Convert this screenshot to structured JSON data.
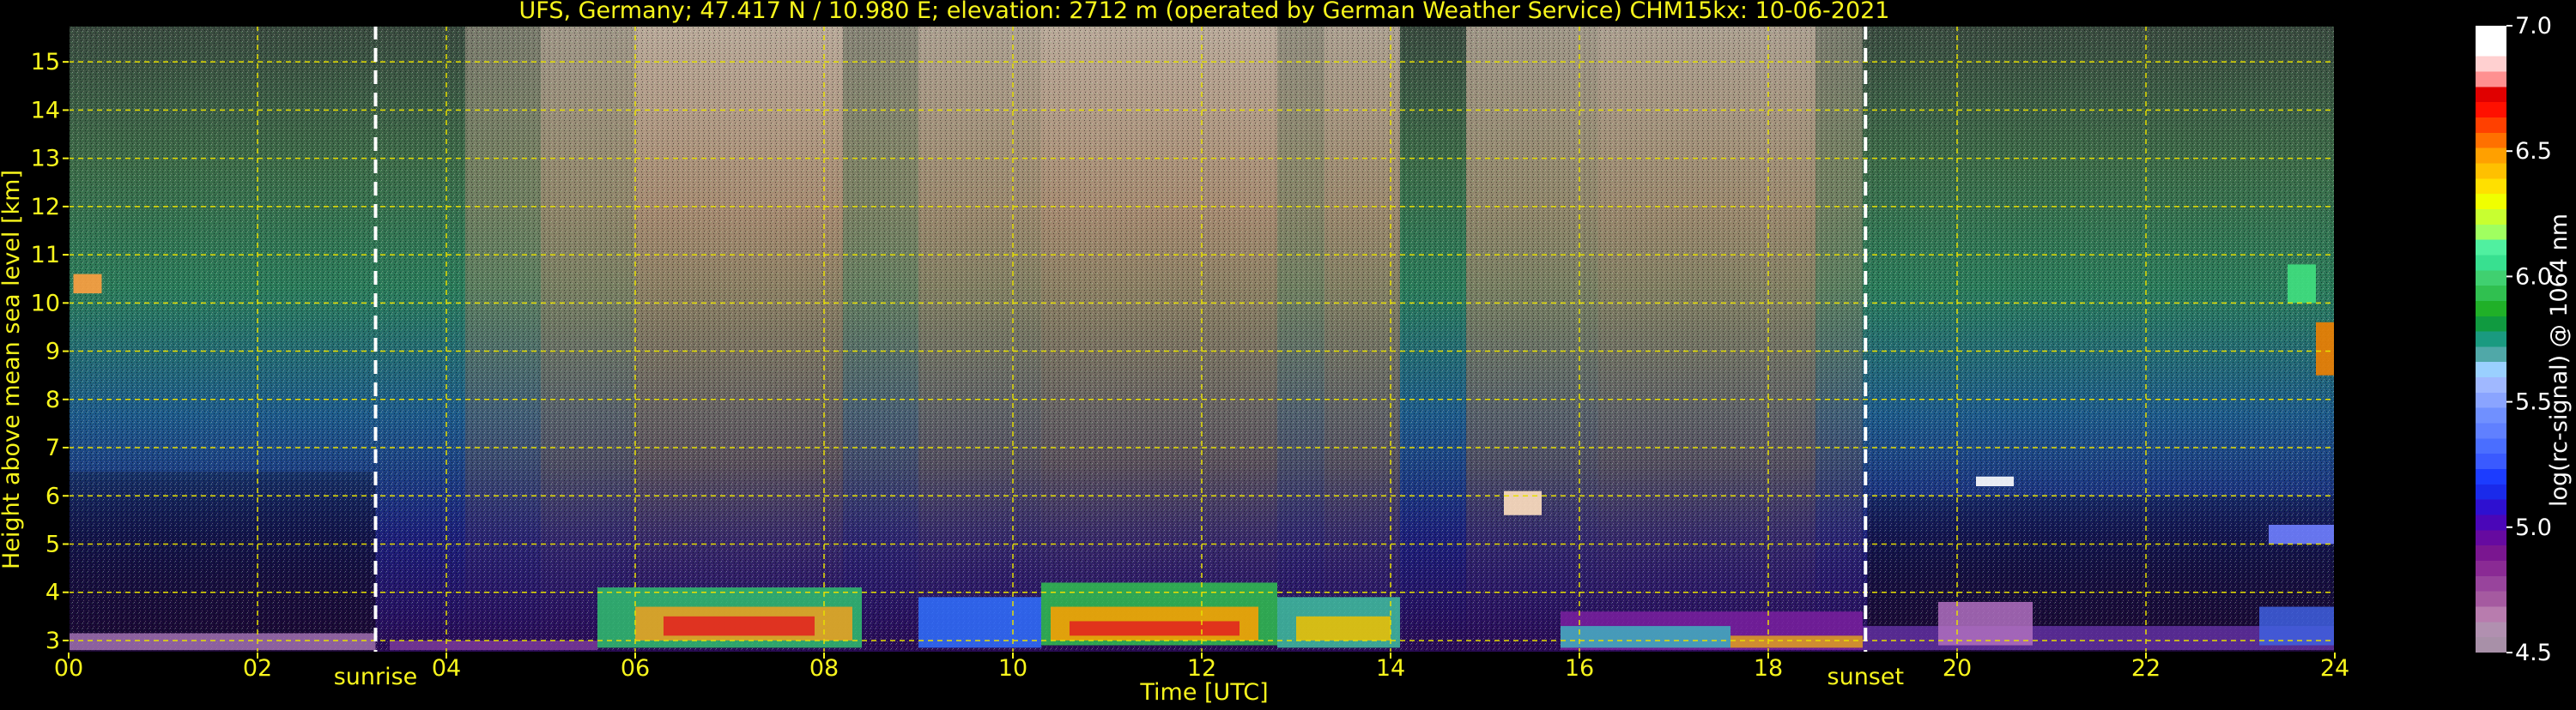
{
  "chart_data": {
    "type": "heatmap",
    "title": "UFS, Germany; 47.417 N / 10.980 E; elevation: 2712 m  (operated by German Weather Service)    CHM15kx: 10-06-2021",
    "xlabel": "Time [UTC]",
    "ylabel": "Height above mean sea level [km]",
    "xlim": [
      0,
      24
    ],
    "ylim": [
      2.75,
      15.75
    ],
    "x_ticks": [
      "00",
      "02",
      "04",
      "06",
      "08",
      "10",
      "12",
      "14",
      "16",
      "18",
      "20",
      "22",
      "24"
    ],
    "y_ticks": [
      "3",
      "4",
      "5",
      "6",
      "7",
      "8",
      "9",
      "10",
      "11",
      "12",
      "13",
      "14",
      "15"
    ],
    "grid": true,
    "annotations": [
      {
        "label": "sunrise",
        "x": 3.25
      },
      {
        "label": "sunset",
        "x": 19.03
      }
    ],
    "colorbar": {
      "label": "log(rc-signal) @ 1064 nm",
      "range": [
        4.5,
        7.0
      ],
      "ticks": [
        "4.5",
        "5.0",
        "5.5",
        "6.0",
        "6.5",
        "7.0"
      ],
      "colors": [
        "#a890a8",
        "#b190b0",
        "#b87cae",
        "#a55aa0",
        "#98449c",
        "#8a2a94",
        "#7a1690",
        "#660aa0",
        "#4a06b8",
        "#2e10d0",
        "#1a2aea",
        "#1c3cff",
        "#3a5aff",
        "#4a6eff",
        "#6080ff",
        "#7090ff",
        "#8aa4ff",
        "#a0b8ff",
        "#9ad0ff",
        "#50a8a8",
        "#1a9a80",
        "#109a40",
        "#20b028",
        "#30c050",
        "#40d070",
        "#38e090",
        "#50f0a0",
        "#a0ff60",
        "#c8ff30",
        "#f0ff00",
        "#ffe000",
        "#ffc000",
        "#ffa000",
        "#ff7000",
        "#ff4000",
        "#ff1000",
        "#e00000",
        "#ff9090",
        "#ffd0d0",
        "#ffffff",
        "#ffffff"
      ]
    }
  }
}
